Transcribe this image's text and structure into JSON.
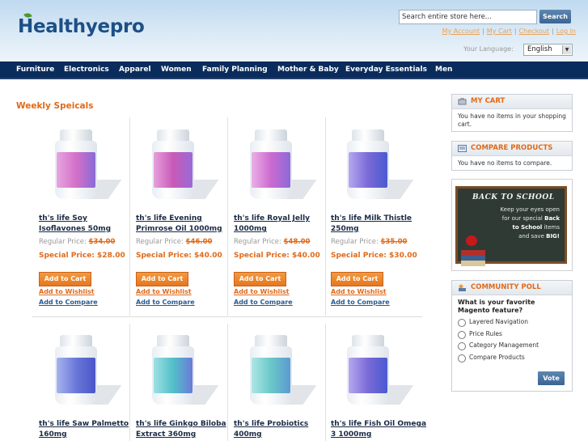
{
  "header": {
    "logo": "Healthyepro",
    "search": {
      "placeholder": "Search entire store here...",
      "value": "Search entire store here...",
      "button_label": "Search"
    },
    "links": [
      "My Account",
      "My Cart",
      "Checkout",
      "Log In"
    ],
    "language_label": "Your Language:",
    "language_value": "English"
  },
  "nav": {
    "items": [
      "Furniture",
      "Electronics",
      "Apparel",
      "Women",
      "Family Planning",
      "Mother & Baby",
      "Everyday Essentials",
      "Men"
    ]
  },
  "main": {
    "title": "Weekly Speicals",
    "regular_price_label": "Regular Price:",
    "special_price_label": "Special Price:",
    "add_to_cart_label": "Add to Cart",
    "add_to_wishlist_label": "Add to Wishlist",
    "add_to_compare_label": "Add to Compare",
    "products": [
      {
        "name": "th's life Soy Isoflavones 50mg",
        "regular_price": "$34.00",
        "special_price": "$28.00",
        "label_color": "#d470c8"
      },
      {
        "name": "th's life Evening Primrose Oil 1000mg",
        "regular_price": "$46.00",
        "special_price": "$40.00",
        "label_color": "#c85ab8"
      },
      {
        "name": "th's life Royal Jelly 1000mg",
        "regular_price": "$48.00",
        "special_price": "$40.00",
        "label_color": "#cc6ad0"
      },
      {
        "name": "th's life Milk Thistle 250mg",
        "regular_price": "$35.00",
        "special_price": "$30.00",
        "label_color": "#7a6ad8"
      },
      {
        "name": "th's life Saw Palmetto 160mg",
        "label_color": "#6a78d8"
      },
      {
        "name": "th's life Ginkgo Biloba Extract 360mg",
        "label_color": "#52c0c8"
      },
      {
        "name": "th's life Probiotics 400mg",
        "label_color": "#6ac8c8"
      },
      {
        "name": "th's life Fish Oil Omega 3 1000mg",
        "label_color": "#7a6ad8"
      }
    ]
  },
  "sidebar": {
    "cart": {
      "title": "MY CART",
      "text": "You have no items in your shopping cart."
    },
    "compare": {
      "title": "COMPARE PRODUCTS",
      "text": "You have no items to compare."
    },
    "banner": {
      "headline": "BACK TO SCHOOL",
      "line1": "Keep your eyes open",
      "line2": "for our special",
      "line2_bold": "Back",
      "line3": "to School",
      "line3_rest": "items",
      "line4": "and save",
      "line4_bold": "BIG!"
    },
    "poll": {
      "title": "COMMUNITY POLL",
      "question": "What is your favorite Magento feature?",
      "options": [
        "Layered Navigation",
        "Price Rules",
        "Category Management",
        "Compare Products"
      ],
      "vote_label": "Vote"
    }
  },
  "colors": {
    "accent": "#e06a1a",
    "nav_bg": "#0a2c5c",
    "link_blue": "#2d5b8f"
  }
}
